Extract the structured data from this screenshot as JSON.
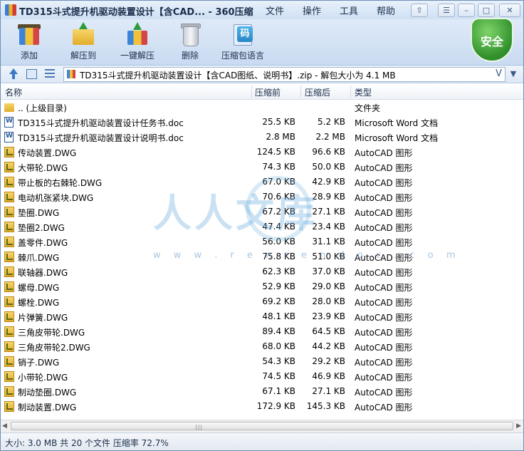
{
  "window": {
    "title": "TD315斗式提升机驱动装置设计【含CAD... - 360压缩",
    "menu": [
      "文件",
      "操作",
      "工具",
      "帮助"
    ],
    "controls": {
      "skin": "⇧",
      "menu": "☰",
      "minimize": "–",
      "maximize": "□",
      "close": "✕"
    }
  },
  "toolbar": {
    "add_label": "添加",
    "extract_label": "解压到",
    "one_click_label": "一键解压",
    "delete_label": "删除",
    "code_label": "压缩包语言",
    "code_glyph": "码",
    "security_label": "安全"
  },
  "address": {
    "path": "TD315斗式提升机驱动装置设计【含CAD图纸、说明书】.zip - 解包大小为 4.1 MB",
    "dropdown_glyph": "V",
    "history_glyph": "▼"
  },
  "columns": {
    "name": "名称",
    "compressed": "压缩前",
    "original": "压缩后",
    "type": "类型"
  },
  "files": [
    {
      "icon": "folder",
      "name": ".. (上级目录)",
      "compressed": "",
      "original": "",
      "type": "文件夹"
    },
    {
      "icon": "doc",
      "name": "TD315斗式提升机驱动装置设计任务书.doc",
      "compressed": "25.5 KB",
      "original": "5.2 KB",
      "type": "Microsoft Word 文档"
    },
    {
      "icon": "doc",
      "name": "TD315斗式提升机驱动装置设计说明书.doc",
      "compressed": "2.8 MB",
      "original": "2.2 MB",
      "type": "Microsoft Word 文档"
    },
    {
      "icon": "dwg",
      "name": "传动装置.DWG",
      "compressed": "124.5 KB",
      "original": "96.6 KB",
      "type": "AutoCAD 图形"
    },
    {
      "icon": "dwg",
      "name": "大带轮.DWG",
      "compressed": "74.3 KB",
      "original": "50.0 KB",
      "type": "AutoCAD 图形"
    },
    {
      "icon": "dwg",
      "name": "带止板的右棘轮.DWG",
      "compressed": "67.0 KB",
      "original": "42.9 KB",
      "type": "AutoCAD 图形"
    },
    {
      "icon": "dwg",
      "name": "电动机张紧块.DWG",
      "compressed": "70.6 KB",
      "original": "28.9 KB",
      "type": "AutoCAD 图形"
    },
    {
      "icon": "dwg",
      "name": "垫圈.DWG",
      "compressed": "67.2 KB",
      "original": "27.1 KB",
      "type": "AutoCAD 图形"
    },
    {
      "icon": "dwg",
      "name": "垫圈2.DWG",
      "compressed": "47.4 KB",
      "original": "23.4 KB",
      "type": "AutoCAD 图形"
    },
    {
      "icon": "dwg",
      "name": "盖零件.DWG",
      "compressed": "56.0 KB",
      "original": "31.1 KB",
      "type": "AutoCAD 图形"
    },
    {
      "icon": "dwg",
      "name": "棘爪.DWG",
      "compressed": "75.8 KB",
      "original": "51.0 KB",
      "type": "AutoCAD 图形"
    },
    {
      "icon": "dwg",
      "name": "联轴器.DWG",
      "compressed": "62.3 KB",
      "original": "37.0 KB",
      "type": "AutoCAD 图形"
    },
    {
      "icon": "dwg",
      "name": "螺母.DWG",
      "compressed": "52.9 KB",
      "original": "29.0 KB",
      "type": "AutoCAD 图形"
    },
    {
      "icon": "dwg",
      "name": "螺栓.DWG",
      "compressed": "69.2 KB",
      "original": "28.0 KB",
      "type": "AutoCAD 图形"
    },
    {
      "icon": "dwg",
      "name": "片弹簧.DWG",
      "compressed": "48.1 KB",
      "original": "23.9 KB",
      "type": "AutoCAD 图形"
    },
    {
      "icon": "dwg",
      "name": "三角皮带轮.DWG",
      "compressed": "89.4 KB",
      "original": "64.5 KB",
      "type": "AutoCAD 图形"
    },
    {
      "icon": "dwg",
      "name": "三角皮带轮2.DWG",
      "compressed": "68.0 KB",
      "original": "44.2 KB",
      "type": "AutoCAD 图形"
    },
    {
      "icon": "dwg",
      "name": "销子.DWG",
      "compressed": "54.3 KB",
      "original": "29.2 KB",
      "type": "AutoCAD 图形"
    },
    {
      "icon": "dwg",
      "name": "小带轮.DWG",
      "compressed": "74.5 KB",
      "original": "46.9 KB",
      "type": "AutoCAD 图形"
    },
    {
      "icon": "dwg",
      "name": "制动垫圈.DWG",
      "compressed": "67.1 KB",
      "original": "27.1 KB",
      "type": "AutoCAD 图形"
    },
    {
      "icon": "dwg",
      "name": "制动装置.DWG",
      "compressed": "172.9 KB",
      "original": "145.3 KB",
      "type": "AutoCAD 图形"
    }
  ],
  "watermark": {
    "text": "人人文库",
    "url": "w w w . r e n r e n d o c . c o m"
  },
  "scrollbar": {
    "left": "◀",
    "right": "▶",
    "grip": "|||"
  },
  "status": {
    "text": "大小: 3.0 MB 共 20 个文件 压缩率 72.7%"
  },
  "colors": {
    "accent": "#3a79c6",
    "security": "#2f8f2a",
    "titlebar": "#cfe0f4"
  }
}
